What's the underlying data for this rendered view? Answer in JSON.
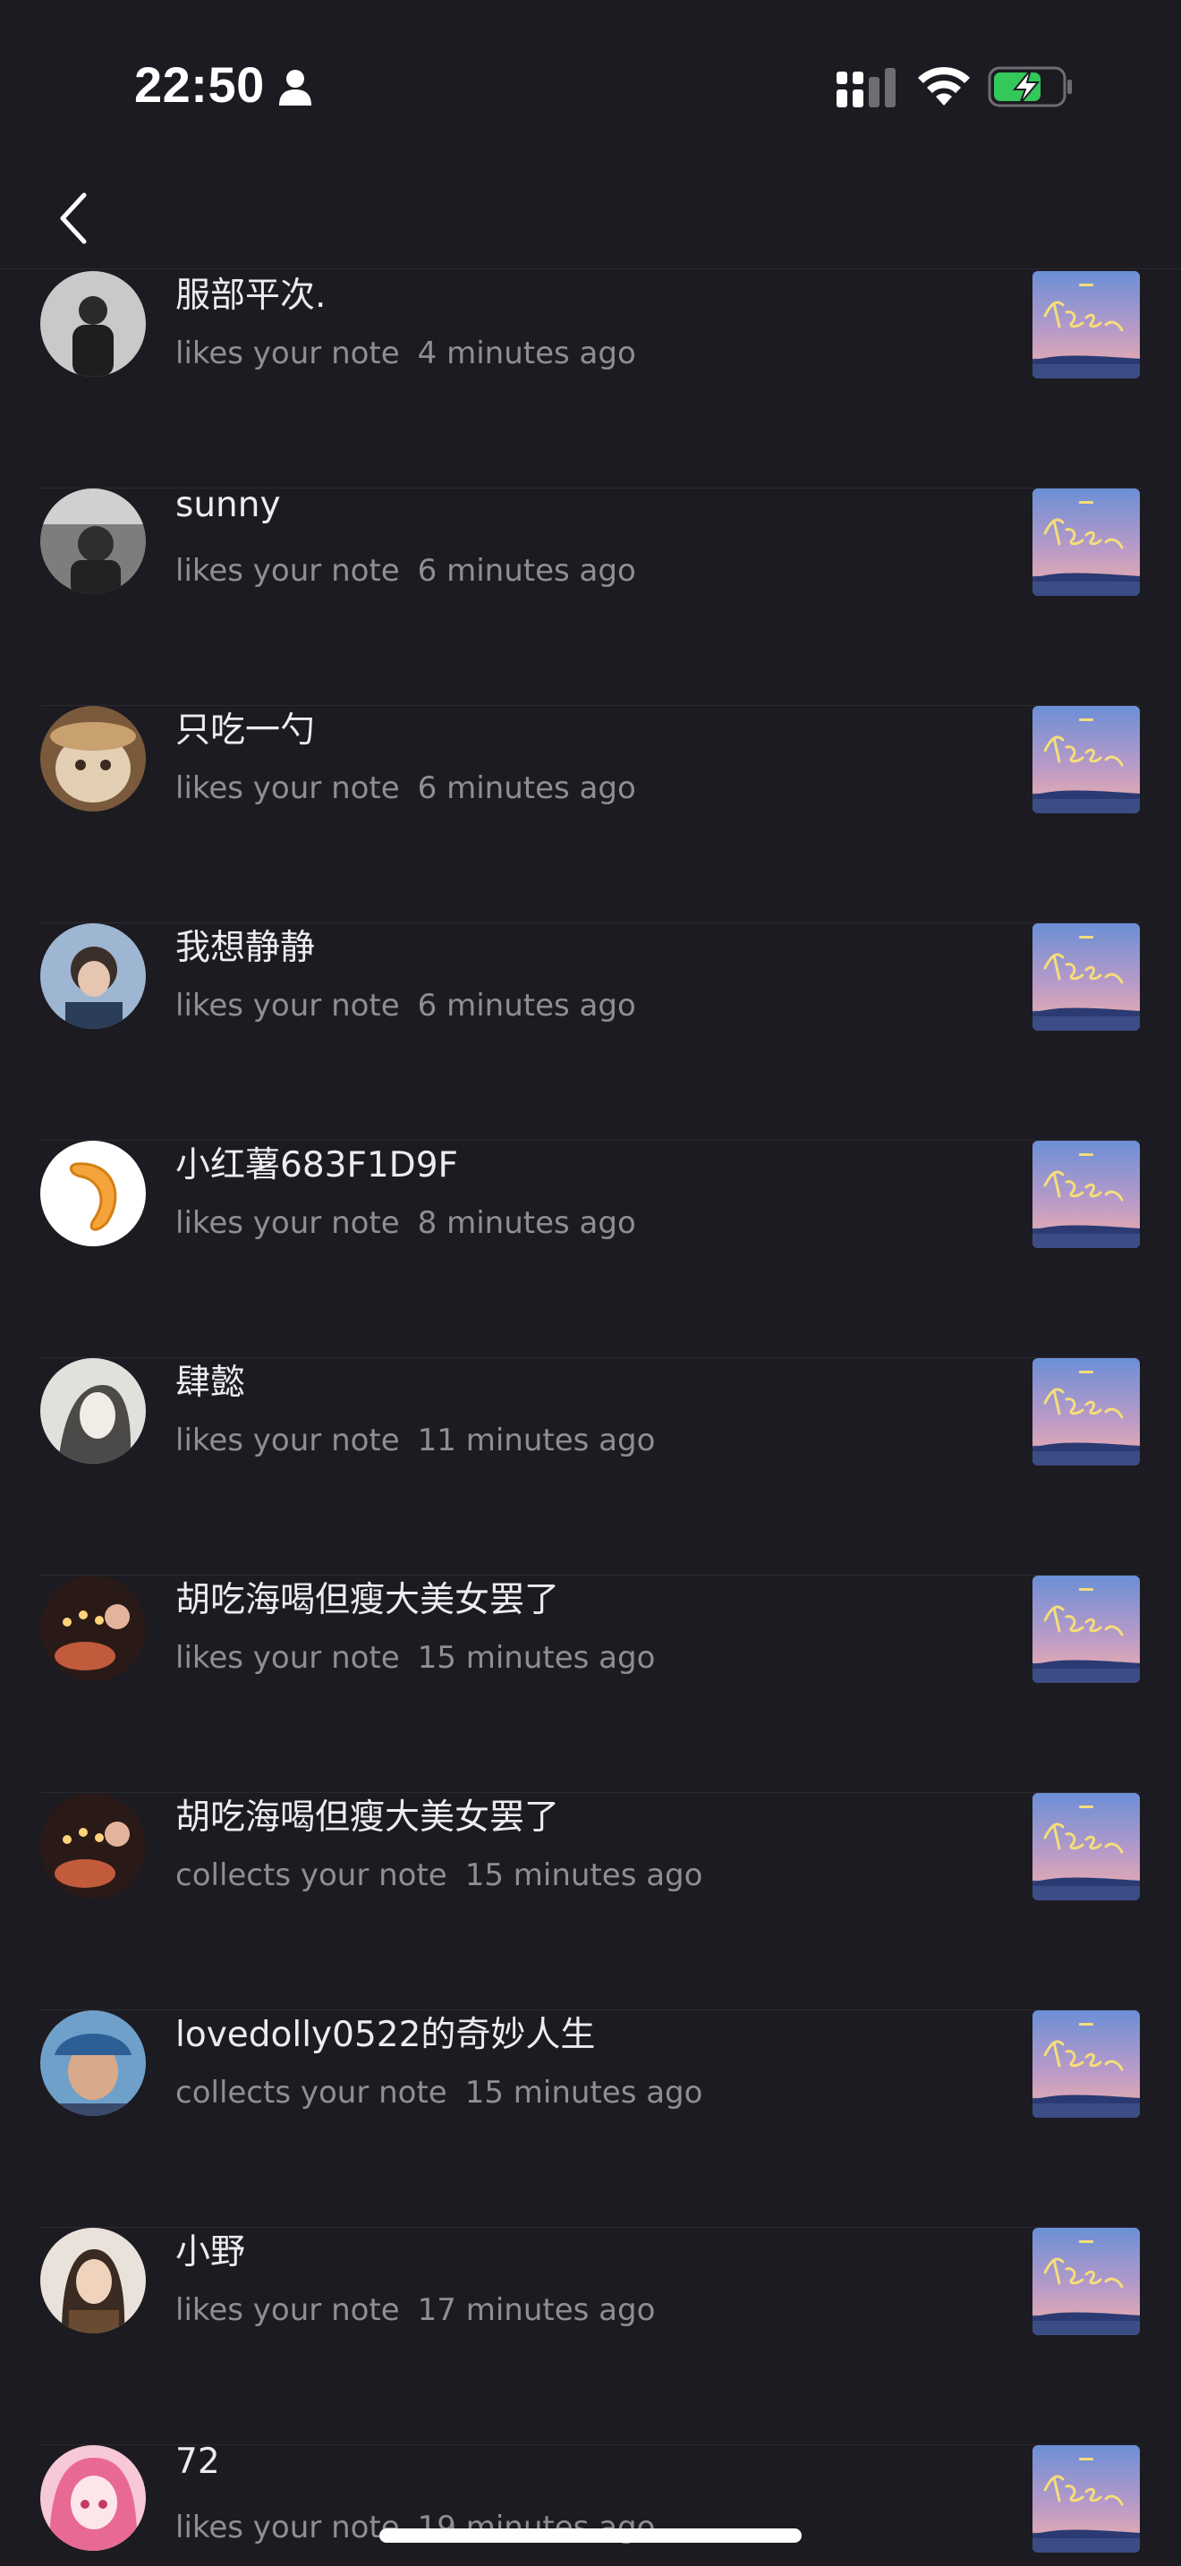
{
  "status_bar": {
    "time": "22:50",
    "icons": [
      "person-icon",
      "cellular-signal-icon",
      "wifi-icon",
      "battery-charging-icon"
    ]
  },
  "nav": {
    "back_icon": "chevron-left-icon"
  },
  "notifications": [
    {
      "username": "服部平次.",
      "action": "likes your note",
      "time": "4 minutes ago",
      "avatar_color": "#bdbdbd"
    },
    {
      "username": "sunny",
      "action": "likes your note",
      "time": "6 minutes ago",
      "avatar_color": "#8c8c8c"
    },
    {
      "username": "只吃一勺",
      "action": "likes your note",
      "time": "6 minutes ago",
      "avatar_color": "#c9a47a"
    },
    {
      "username": "我想静静",
      "action": "likes your note",
      "time": "6 minutes ago",
      "avatar_color": "#6f86a8"
    },
    {
      "username": "小红薯683F1D9F",
      "action": "likes your note",
      "time": "8 minutes ago",
      "avatar_color": "#ffffff"
    },
    {
      "username": "肆懿",
      "action": "likes your note",
      "time": "11 minutes ago",
      "avatar_color": "#d8d6d4"
    },
    {
      "username": "胡吃海喝但瘦大美女罢了",
      "action": "likes your note",
      "time": "15 minutes ago",
      "avatar_color": "#3a2420"
    },
    {
      "username": "胡吃海喝但瘦大美女罢了",
      "action": "collects your note",
      "time": "15 minutes ago",
      "avatar_color": "#3a2420"
    },
    {
      "username": "lovedolly0522的奇妙人生",
      "action": "collects your note",
      "time": "15 minutes ago",
      "avatar_color": "#4a7fb8"
    },
    {
      "username": "小野",
      "action": "likes your note",
      "time": "17 minutes ago",
      "avatar_color": "#b59a86"
    },
    {
      "username": "72",
      "action": "likes your note",
      "time": "19 minutes ago",
      "avatar_color": "#f0a8c0"
    }
  ],
  "colors": {
    "background": "#1c1b21",
    "primary_text": "#ececf0",
    "secondary_text": "#8f8e95",
    "divider": "#2b2a31"
  }
}
